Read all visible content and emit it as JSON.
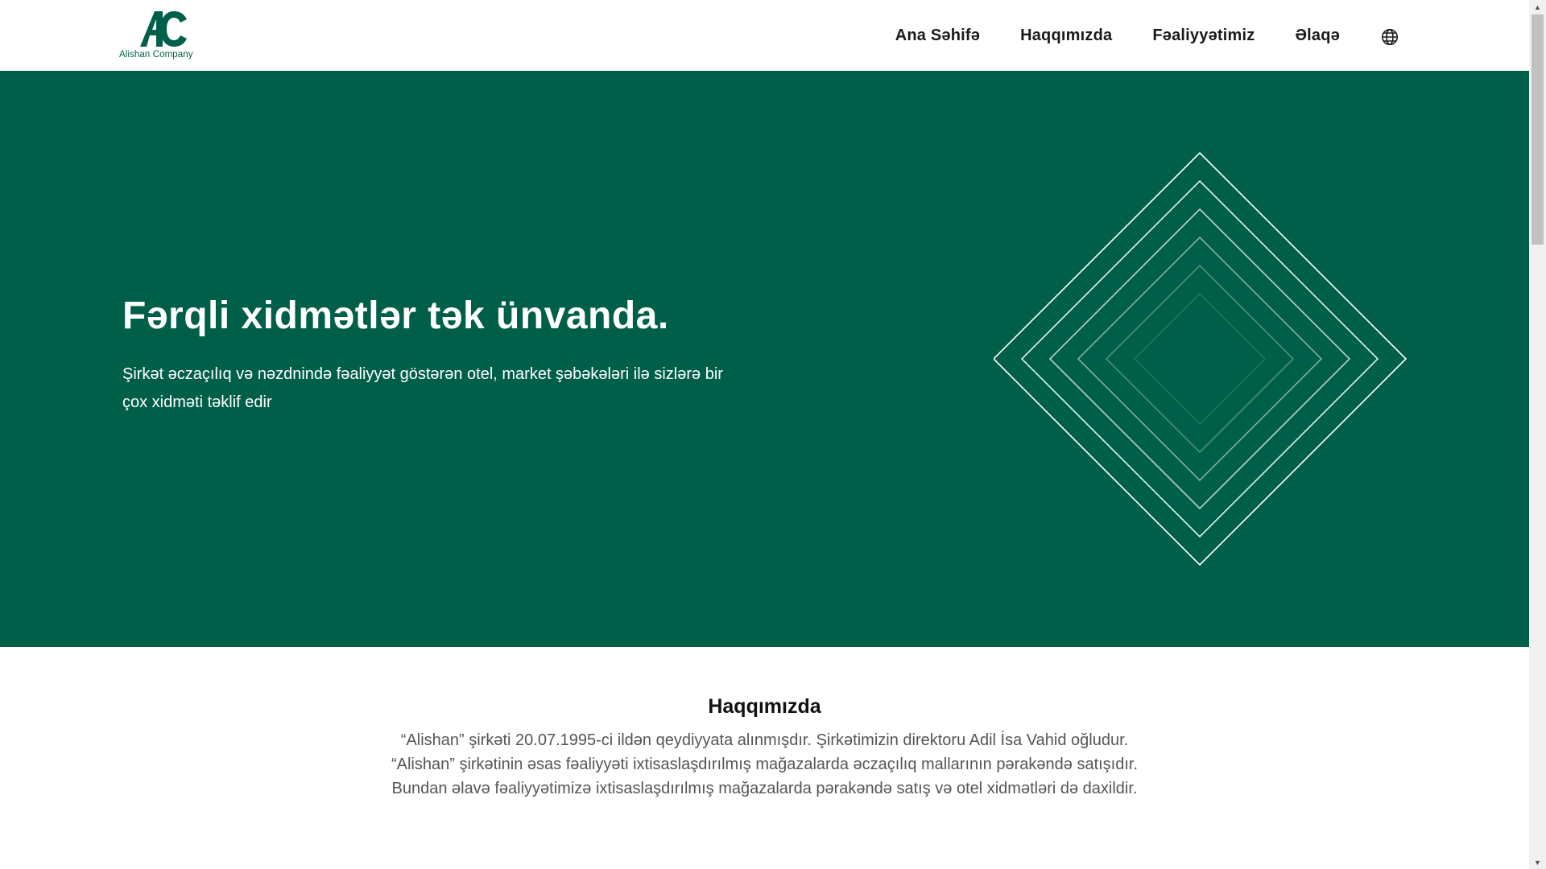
{
  "brand": {
    "logo_name": "Alishan Company",
    "colors": {
      "primary": "#005f48",
      "white": "#ffffff"
    }
  },
  "nav": {
    "items": [
      {
        "label": "Ana Səhifə"
      },
      {
        "label": "Haqqımızda"
      },
      {
        "label": "Fəaliyyətimiz"
      },
      {
        "label": "Əlaqə"
      }
    ],
    "language_icon": "globe-icon"
  },
  "hero": {
    "title": "Fərqli xidmətlər tək ünvanda.",
    "subtitle": "Şirkət əczaçılıq və nəzdnində fəaliyyət göstərən otel, market şəbəkələri ilə sizlərə bir çox xidməti təklif edir",
    "decoration_icon": "nested-diamonds-icon"
  },
  "about": {
    "title": "Haqqımızda",
    "text": "“Alishan” şirkəti 20.07.1995-ci ildən qeydiyyata alınmışdır. Şirkətimizin direktoru Adil İsa Vahid oğludur. “Alishan” şirkətinin əsas fəaliyyəti ixtisaslaşdırılmış mağazalarda əczaçılıq mallarının pərakəndə satışıdır. Bundan əlavə fəaliyyətimizə ixtisaslaşdırılmış mağazalarda pərakəndə satış və otel xidmətləri də daxildir."
  }
}
